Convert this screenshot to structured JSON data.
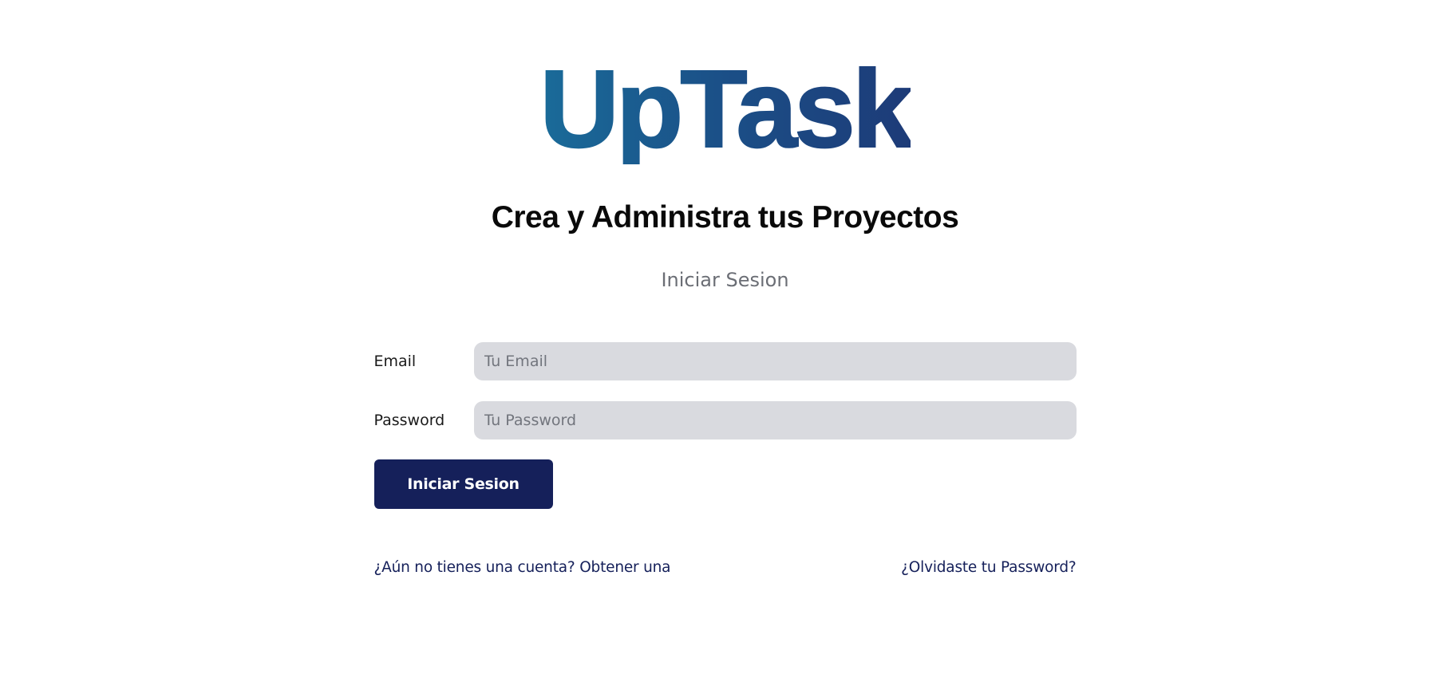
{
  "logo": {
    "text": "UpTask",
    "gradient_start": "#1a6b99",
    "gradient_end": "#1d3b78"
  },
  "tagline": "Crea y Administra tus Proyectos",
  "subtitle": "Iniciar Sesion",
  "form": {
    "email": {
      "label": "Email",
      "placeholder": "Tu Email",
      "value": ""
    },
    "password": {
      "label": "Password",
      "placeholder": "Tu Password",
      "value": ""
    },
    "submit_label": "Iniciar Sesion"
  },
  "links": {
    "register": "¿Aún no tienes una cuenta? Obtener una",
    "forgot": "¿Olvidaste tu Password?"
  },
  "colors": {
    "primary": "#15205a",
    "input_bg": "#d9dadf",
    "subtitle": "#6b6e75"
  }
}
